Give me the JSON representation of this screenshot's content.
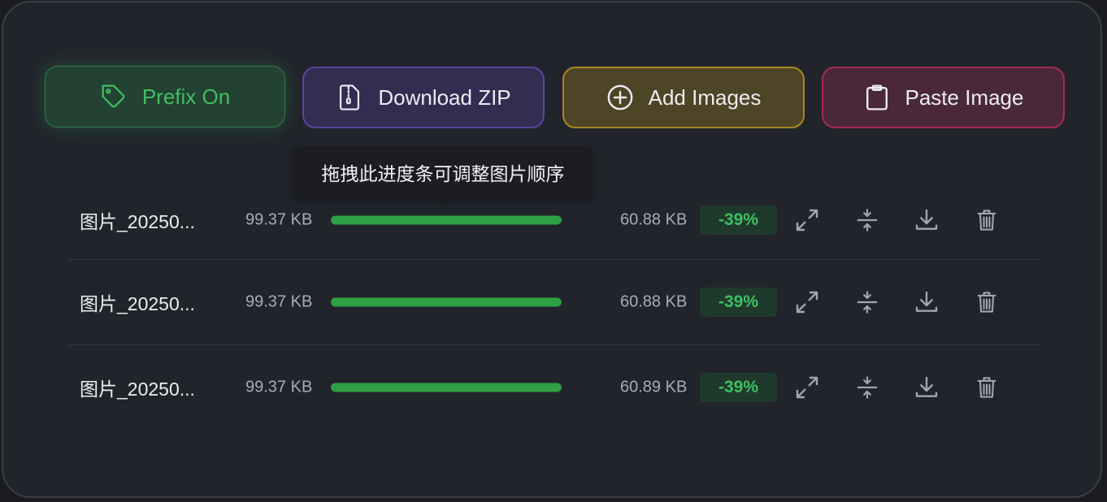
{
  "toolbar": {
    "prefix_label": "Prefix On",
    "download_zip_label": "Download ZIP",
    "add_images_label": "Add Images",
    "paste_image_label": "Paste Image"
  },
  "tooltip": {
    "text": "拖拽此进度条可调整图片顺序"
  },
  "colors": {
    "progress": "#2ea043",
    "savings_text": "#3fbf63",
    "prefix_accent": "#3fbf63",
    "zip_border": "#5a45a0",
    "add_border": "#a68a20",
    "paste_border": "#a62a54"
  },
  "files": [
    {
      "name": "图片_20250...",
      "original_size": "99.37 KB",
      "compressed_size": "60.88 KB",
      "savings": "-39%",
      "progress": 1.0
    },
    {
      "name": "图片_20250...",
      "original_size": "99.37 KB",
      "compressed_size": "60.88 KB",
      "savings": "-39%",
      "progress": 1.0
    },
    {
      "name": "图片_20250...",
      "original_size": "99.37 KB",
      "compressed_size": "60.89 KB",
      "savings": "-39%",
      "progress": 1.0
    }
  ],
  "row_actions": [
    "expand-icon",
    "compress-icon",
    "download-icon",
    "trash-icon"
  ]
}
